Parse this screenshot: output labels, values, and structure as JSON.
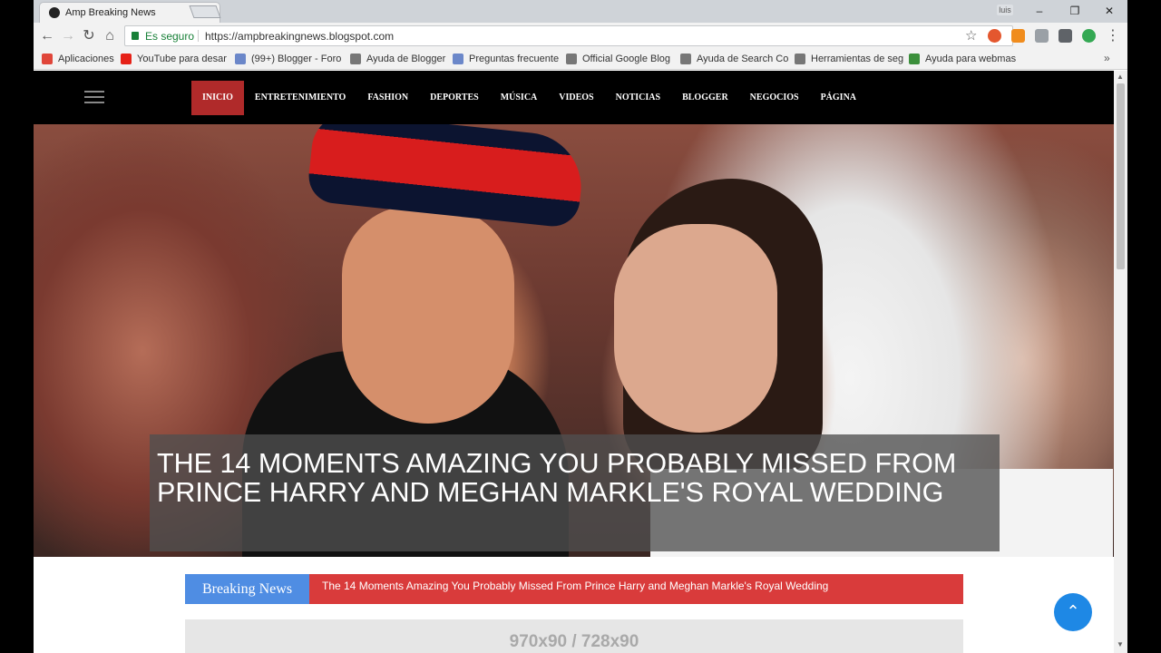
{
  "window": {
    "tab_title": "Amp Breaking News",
    "user": "luis",
    "controls": [
      "–",
      "❐",
      "✕"
    ]
  },
  "address_bar": {
    "secure_label": "Es seguro",
    "url": "https://ampbreakingnews.blogspot.com"
  },
  "bookmarks": [
    {
      "label": "Aplicaciones",
      "icon": "apps-icon",
      "color": "#e0463a"
    },
    {
      "label": "YouTube para desar",
      "icon": "youtube-icon",
      "color": "#e62117"
    },
    {
      "label": "(99+) Blogger - Foro",
      "icon": "blogger-icon",
      "color": "#6b87c9"
    },
    {
      "label": "Ayuda de Blogger",
      "icon": "google-icon",
      "color": "#777777"
    },
    {
      "label": "Preguntas frecuente",
      "icon": "blogger-icon",
      "color": "#6b87c9"
    },
    {
      "label": "Official Google Blog",
      "icon": "google-icon",
      "color": "#777777"
    },
    {
      "label": "Ayuda de Search Co",
      "icon": "google-icon",
      "color": "#777777"
    },
    {
      "label": "Herramientas de seg",
      "icon": "google-icon",
      "color": "#777777"
    },
    {
      "label": "Ayuda para webmas",
      "icon": "webmaster-icon",
      "color": "#3b8f3b"
    }
  ],
  "site": {
    "menu": [
      "Inicio",
      "Entretenimiento",
      "Fashion",
      "Deportes",
      "Música",
      "Videos",
      "Noticias",
      "Blogger",
      "Negocios",
      "Página"
    ],
    "hero_title": "THE 14 MOMENTS AMAZING YOU PROBABLY MISSED FROM PRINCE HARRY AND MEGHAN MARKLE'S ROYAL WEDDING",
    "breaking_label": "Breaking News",
    "breaking_text": "The 14 Moments Amazing You Probably Missed From Prince Harry and Meghan Markle's Royal Wedding",
    "ad_text": "970x90 / 728x90"
  },
  "colors": {
    "accent_red": "#b02a2a",
    "breaking_blue": "#4f8de3",
    "breaking_red": "#d93b3b",
    "scroll_button": "#1e88e5"
  }
}
